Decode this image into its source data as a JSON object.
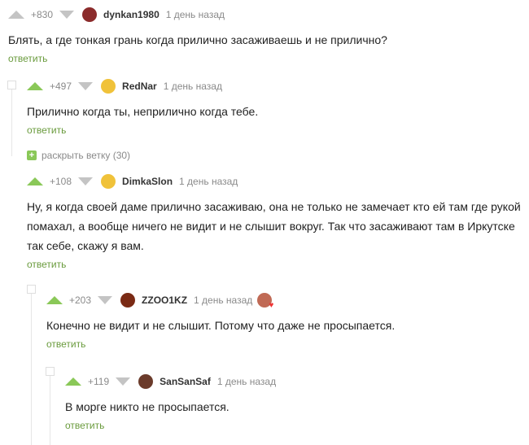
{
  "comments": [
    {
      "rating": "+830",
      "user": "dynkan1980",
      "time": "1 день назад",
      "text": "Блять, а где тонкая грань когда прилично засаживаешь и не прилично?",
      "reply": "ответить",
      "avatar_color": "#8b2b2b"
    },
    {
      "rating": "+497",
      "user": "RedNar",
      "time": "1 день назад",
      "text": "Прилично когда ты, неприлично когда тебе.",
      "reply": "ответить",
      "avatar_color": "#f0c23a"
    },
    {
      "rating": "+108",
      "user": "DimkaSlon",
      "time": "1 день назад",
      "text": "Ну, я когда своей даме прилично засаживаю, она не только не замечает кто ей там где рукой помахал, а вообще ничего не видит и не слышит вокруг. Так что засаживают там в Иркутске так себе, скажу я вам.",
      "reply": "ответить",
      "avatar_color": "#f0c23a"
    },
    {
      "rating": "+203",
      "user": "ZZOO1KZ",
      "time": "1 день назад",
      "text": "Конечно не видит и не слышит. Потому что даже не просыпается.",
      "reply": "ответить",
      "avatar_color": "#7a2a14"
    },
    {
      "rating": "+119",
      "user": "SanSanSaf",
      "time": "1 день назад",
      "text": "В морге никто не просыпается.",
      "reply": "ответить",
      "avatar_color": "#6b3b2b"
    }
  ],
  "expand_branch": "раскрыть ветку (30)",
  "expand_icon": "+",
  "colors": {
    "green": "#8ac858",
    "reply": "#6a9b3d"
  }
}
